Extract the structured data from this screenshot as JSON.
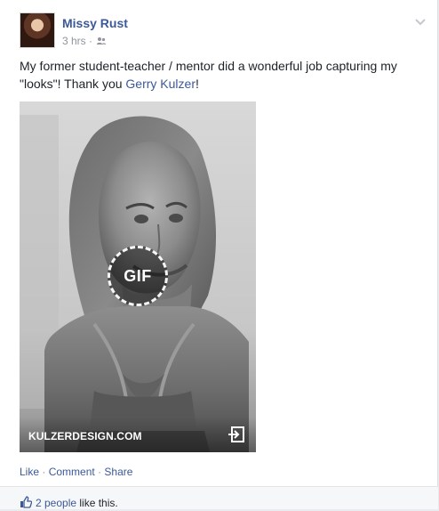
{
  "post": {
    "author": "Missy Rust",
    "timestamp": "3 hrs",
    "meta_separator": "·",
    "privacy_icon": "friends-icon",
    "text_before_link": "My former student-teacher / mentor did a wonderful job capturing my \"looks\"! Thank you ",
    "tagged_name": "Gerry Kulzer",
    "text_after_link": "!",
    "media": {
      "type_badge": "GIF",
      "source": "KULZERDESIGN.COM",
      "open_icon": "external-link-icon"
    },
    "actions": {
      "like": "Like",
      "separator1": "·",
      "comment": "Comment",
      "separator2": "·",
      "share": "Share"
    },
    "likes": {
      "count_text": "2 people",
      "suffix": " like this.",
      "icon": "thumbs-up-icon"
    },
    "menu_icon": "chevron-down-icon"
  },
  "colors": {
    "link": "#3b5998",
    "text": "#1d2129",
    "muted": "#90949c",
    "footer_bg": "#f6f7f9"
  }
}
